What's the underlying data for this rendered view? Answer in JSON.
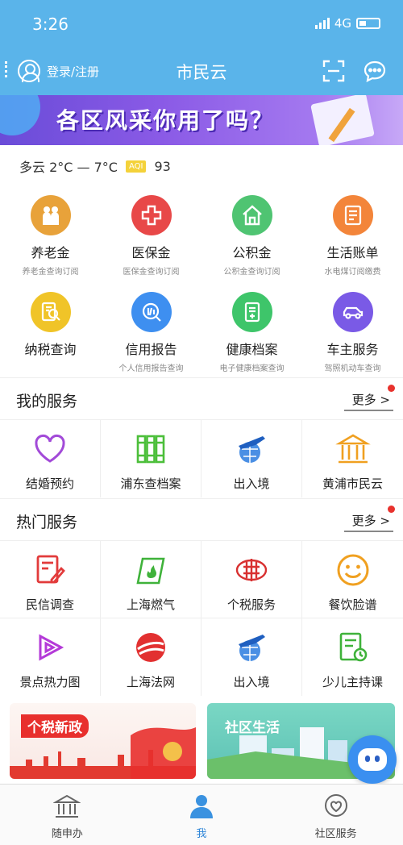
{
  "status": {
    "time": "3:26",
    "network": "4G"
  },
  "header": {
    "login_label": "登录/注册",
    "title": "市民云"
  },
  "banner": {
    "text": "各区风采你用了吗？"
  },
  "weather": {
    "text": "多云 2°C — 7°C",
    "aqi_label": "AQI",
    "aqi_value": "93"
  },
  "quick": [
    {
      "label": "养老金",
      "sub": "养老金查询订阅",
      "icon": "elderly-icon",
      "color": "#e8a23a"
    },
    {
      "label": "医保金",
      "sub": "医保金查询订阅",
      "icon": "medical-cross-icon",
      "color": "#e84848"
    },
    {
      "label": "公积金",
      "sub": "公积金查询订阅",
      "icon": "house-icon",
      "color": "#4fc472"
    },
    {
      "label": "生活账单",
      "sub": "水电煤订阅缴费",
      "icon": "bill-icon",
      "color": "#f3853a"
    },
    {
      "label": "纳税查询",
      "sub": "",
      "icon": "tax-search-icon",
      "color": "#f0c428"
    },
    {
      "label": "信用报告",
      "sub": "个人信用报告查询",
      "icon": "credit-icon",
      "color": "#3e8ff0"
    },
    {
      "label": "健康档案",
      "sub": "电子健康档案查询",
      "icon": "health-file-icon",
      "color": "#3ec56a"
    },
    {
      "label": "车主服务",
      "sub": "驾照机动车查询",
      "icon": "car-icon",
      "color": "#7a5ae6"
    }
  ],
  "my_services": {
    "title": "我的服务",
    "more": "更多 >",
    "items": [
      {
        "label": "结婚预约",
        "icon": "heart-icon"
      },
      {
        "label": "浦东查档案",
        "icon": "archive-icon"
      },
      {
        "label": "出入境",
        "icon": "plane-globe-icon"
      },
      {
        "label": "黄浦市民云",
        "icon": "building-icon"
      }
    ]
  },
  "hot_services": {
    "title": "热门服务",
    "more": "更多 >",
    "items": [
      {
        "label": "民信调查",
        "icon": "survey-icon"
      },
      {
        "label": "上海燃气",
        "icon": "gas-icon"
      },
      {
        "label": "个税服务",
        "icon": "tax-emblem-icon"
      },
      {
        "label": "餐饮脸谱",
        "icon": "smile-icon"
      },
      {
        "label": "景点热力图",
        "icon": "play-icon"
      },
      {
        "label": "上海法网",
        "icon": "law-icon"
      },
      {
        "label": "出入境",
        "icon": "plane-globe-icon"
      },
      {
        "label": "少儿主持课",
        "icon": "course-icon"
      }
    ]
  },
  "promos": [
    {
      "title": "个税新政"
    },
    {
      "title": "社区生活"
    }
  ],
  "tabs": [
    {
      "label": "随申办",
      "icon": "government-icon"
    },
    {
      "label": "我",
      "icon": "person-icon"
    },
    {
      "label": "社区服务",
      "icon": "heart-bubble-icon"
    }
  ]
}
